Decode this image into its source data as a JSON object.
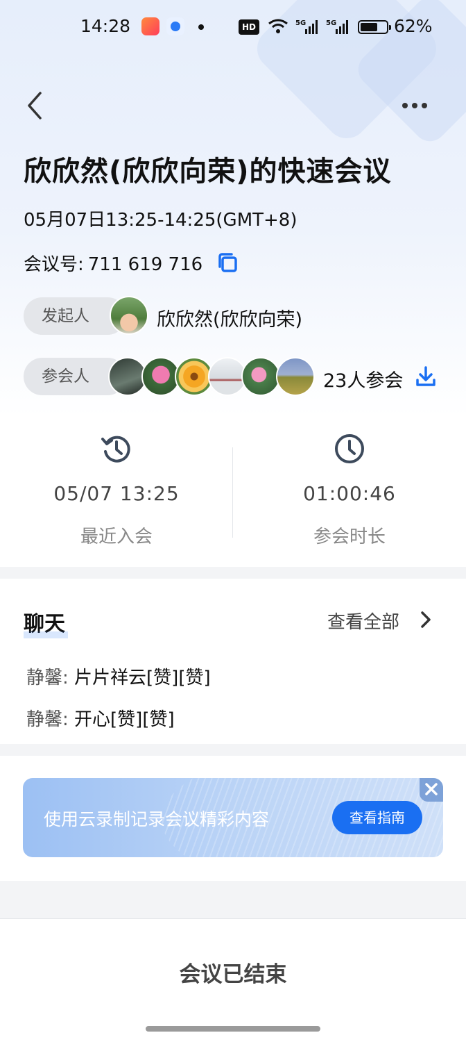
{
  "status_bar": {
    "time": "14:28",
    "battery_pct": "62%",
    "hd_label": "HD"
  },
  "header": {
    "title": "欣欣然(欣欣向荣)的快速会议"
  },
  "meeting": {
    "time_range": "05月07日13:25-14:25(GMT+8)",
    "id_label": "会议号:",
    "id_value": "711 619 716"
  },
  "host": {
    "tag": "发起人",
    "name": "欣欣然(欣欣向荣)"
  },
  "attendees": {
    "tag": "参会人",
    "count_text": "23人参会"
  },
  "stats": {
    "last_join": {
      "value": "05/07 13:25",
      "label": "最近入会"
    },
    "duration": {
      "value": "01:00:46",
      "label": "参会时长"
    }
  },
  "chat": {
    "title": "聊天",
    "view_all": "查看全部",
    "messages": [
      {
        "sender": "静馨:",
        "text": "片片祥云[赞][赞]"
      },
      {
        "sender": "静馨:",
        "text": "开心[赞][赞]"
      }
    ]
  },
  "banner": {
    "text": "使用云录制记录会议精彩内容",
    "button": "查看指南"
  },
  "footer": {
    "status": "会议已结束"
  },
  "colors": {
    "accent": "#1a6ff2",
    "bg": "#f3f4f6"
  }
}
